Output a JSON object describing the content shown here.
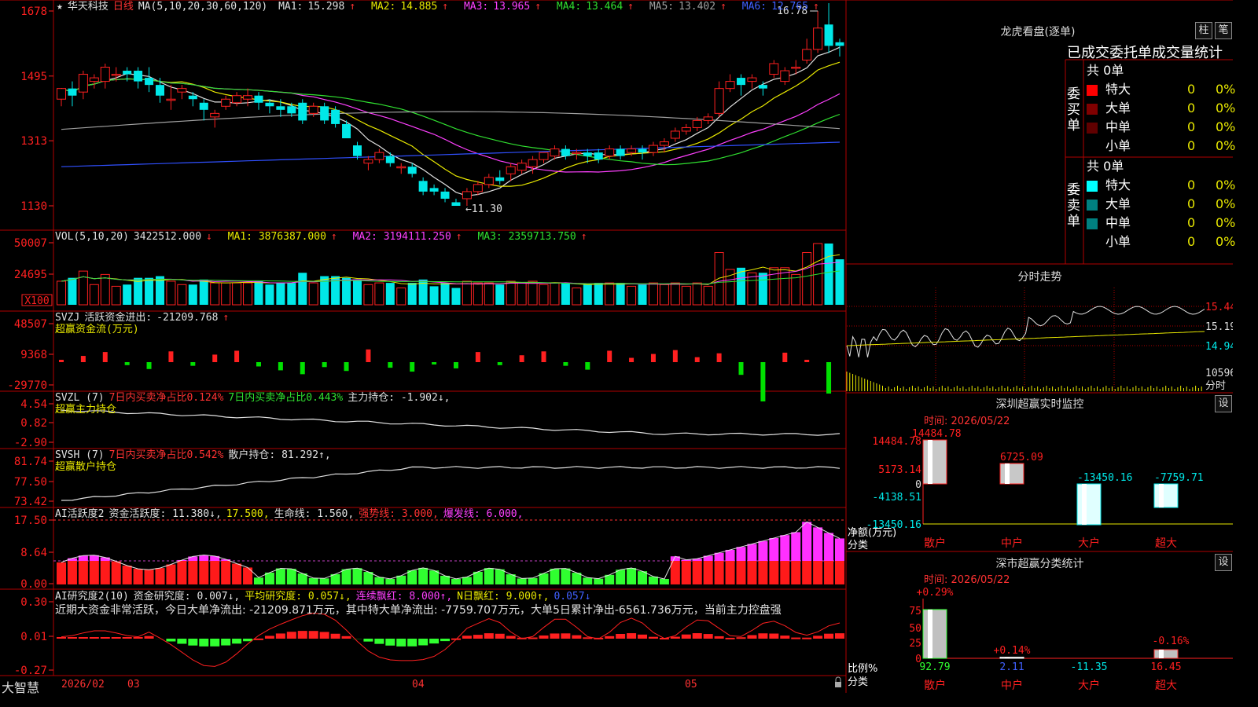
{
  "header": {
    "stock_name": "华天科技",
    "period": "日线",
    "ma_title": "MA(5,10,20,30,60,120)",
    "ma": [
      {
        "label": "MA1:",
        "value": "15.298",
        "arrow": "↑",
        "color": "#e0e0e0"
      },
      {
        "label": "MA2:",
        "value": "14.885",
        "arrow": "↑",
        "color": "#e8e800"
      },
      {
        "label": "MA3:",
        "value": "13.965",
        "arrow": "↑",
        "color": "#ff40ff"
      },
      {
        "label": "MA4:",
        "value": "13.464",
        "arrow": "↑",
        "color": "#30e030"
      },
      {
        "label": "MA5:",
        "value": "13.402",
        "arrow": "↑",
        "color": "#c0c0c0"
      },
      {
        "label": "MA6:",
        "value": "12.765",
        "arrow": "↑",
        "color": "#4060ff"
      }
    ],
    "price_ticks": [
      "1678",
      "1495",
      "1313",
      "1130"
    ],
    "high_mark": "16.78",
    "low_mark": "11.30"
  },
  "vol": {
    "title": "VOL(5,10,20)",
    "value": "3422512.000",
    "value_arrow": "↓",
    "ma1": "3876387.000",
    "ma2": "3194111.250",
    "ma3": "2359713.750",
    "arrow_up": "↑",
    "ticks": [
      "50007",
      "24695"
    ],
    "unit": "X100"
  },
  "svzj": {
    "title": "SVZJ",
    "label": "活跃资金进出:",
    "value": "-21209.768",
    "arrow": "↑",
    "subtitle": "超赢资金流(万元)",
    "ticks": [
      "48507",
      "9368",
      "-29770"
    ]
  },
  "svzl": {
    "title": "SVZL (7)",
    "t1": "7日内买卖净占比0.124%",
    "t2": "7日内买卖净占比0.443%",
    "t3": "主力持仓: -1.902↓,",
    "subtitle": "超赢主力持仓",
    "ticks": [
      "4.54",
      "0.82",
      "-2.90"
    ]
  },
  "svsh": {
    "title": "SVSH (7)",
    "t1": "7日内买卖净占比0.542%",
    "t2": "散户持仓: 81.292↑,",
    "subtitle": "超赢散户持仓",
    "ticks": [
      "81.74",
      "77.50",
      "73.42"
    ]
  },
  "ai1": {
    "title": "AI活跃度2",
    "t1": "资金活跃度: 11.380↓,",
    "t2": "17.500,",
    "t3": "生命线: 1.560,",
    "t4": "强势线: 3.000,",
    "t5": "爆发线: 6.000,",
    "ticks": [
      "17.50",
      "8.64",
      "0.00"
    ]
  },
  "ai2": {
    "title": "AI研究度2(10)",
    "t1": "资金研究度: 0.007↓,",
    "t2": "平均研究度: 0.057↓,",
    "t3": "连续飘红: 8.000↑,",
    "t4": "N日飘红: 9.000↑,",
    "t5": "0.057↓",
    "note": "近期大资金非常活跃，今日大单净流出: -21209.871万元，其中特大单净流出: -7759.707万元，大单5日累计净出-6561.736万元，当前主力控盘强",
    "ticks": [
      "0.30",
      "0.01",
      "-0.27"
    ]
  },
  "xaxis": {
    "brand": "大智慧",
    "labels": [
      "2026/02",
      "03",
      "04",
      "05"
    ]
  },
  "lhkp": {
    "title": "龙虎看盘(逐单)",
    "btn1": "柱",
    "btn2": "笔",
    "tabs_title": "已成交委托单成交量统计",
    "buy_label": "委买单",
    "sell_label": "委卖单",
    "buy_total": "共 0单",
    "sell_total": "共 0单",
    "buy_rows": [
      {
        "name": "特大",
        "count": "0",
        "pct": "0%",
        "color": "#ff0000"
      },
      {
        "name": "大单",
        "count": "0",
        "pct": "0%",
        "color": "#800000"
      },
      {
        "name": "中单",
        "count": "0",
        "pct": "0%",
        "color": "#600000"
      },
      {
        "name": "小单",
        "count": "0",
        "pct": "0%",
        "color": "#000000"
      }
    ],
    "sell_rows": [
      {
        "name": "特大",
        "count": "0",
        "pct": "0%",
        "color": "#00ffff"
      },
      {
        "name": "大单",
        "count": "0",
        "pct": "0%",
        "color": "#008080"
      },
      {
        "name": "中单",
        "count": "0",
        "pct": "0%",
        "color": "#008080"
      },
      {
        "name": "小单",
        "count": "0",
        "pct": "0%",
        "color": "#000000"
      }
    ]
  },
  "fenshi": {
    "title": "分时走势",
    "price_ticks": [
      "15.44",
      "15.19",
      "14.94"
    ],
    "vol_tick": "10596",
    "vol_label": "分时"
  },
  "monitor": {
    "title": "深圳超赢实时监控",
    "btn": "设",
    "date": "时间: 2026/05/22",
    "ticks": [
      "14484.78",
      "5173.14",
      "0",
      "-4138.51",
      "-13450.16"
    ],
    "ylabel": "净额(万元)",
    "xlabel_title": "分类",
    "categories": [
      "散户",
      "中户",
      "大户",
      "超大"
    ],
    "values": [
      14484.78,
      6725.09,
      -13450.16,
      -7759.71
    ],
    "value_labels": [
      "14484.78",
      "6725.09",
      "-13450.16",
      "-7759.71"
    ]
  },
  "classify": {
    "title": "深市超赢分类统计",
    "btn": "设",
    "date": "时间: 2026/05/22",
    "ticks": [
      "75",
      "50",
      "25",
      "0"
    ],
    "ylabel": "比例%",
    "xlabel_title": "分类",
    "categories": [
      "散户",
      "中户",
      "大户",
      "超大"
    ],
    "top_labels": [
      "+0.29%",
      "+0.14%",
      "",
      "-0.16%"
    ],
    "bottom_values": [
      "92.79",
      "2.11",
      "-11.35",
      "16.45"
    ],
    "values": [
      92.79,
      2.11,
      0,
      16.45
    ]
  },
  "chart_data": {
    "type": "candlestick",
    "title": "华天科技 日线",
    "ylim": [
      11.3,
      16.78
    ],
    "candles": [
      [
        14.3,
        14.6,
        14.1,
        14.5
      ],
      [
        14.6,
        14.4,
        14.1,
        14.8
      ],
      [
        14.5,
        15.0,
        14.3,
        15.1
      ],
      [
        14.8,
        14.9,
        14.6,
        15.0
      ],
      [
        14.8,
        15.2,
        14.6,
        15.3
      ],
      [
        15.0,
        15.0,
        14.8,
        15.2
      ],
      [
        15.1,
        15.0,
        14.8,
        15.2
      ],
      [
        15.1,
        14.8,
        14.6,
        15.2
      ],
      [
        14.9,
        14.7,
        14.5,
        15.2
      ],
      [
        14.7,
        14.4,
        14.2,
        14.9
      ],
      [
        14.3,
        14.3,
        14.0,
        14.7
      ],
      [
        14.5,
        14.6,
        14.3,
        14.7
      ],
      [
        14.4,
        14.3,
        14.1,
        14.5
      ],
      [
        14.2,
        14.0,
        13.7,
        14.3
      ],
      [
        13.8,
        13.9,
        13.5,
        14.0
      ],
      [
        14.1,
        14.3,
        14.0,
        14.4
      ],
      [
        14.2,
        14.4,
        14.1,
        14.5
      ],
      [
        14.3,
        14.4,
        14.1,
        14.6
      ],
      [
        14.4,
        14.2,
        14.0,
        14.5
      ],
      [
        14.2,
        14.1,
        13.9,
        14.3
      ],
      [
        14.1,
        14.0,
        13.8,
        14.3
      ],
      [
        14.1,
        13.9,
        13.8,
        14.2
      ],
      [
        14.2,
        13.7,
        13.6,
        14.3
      ],
      [
        13.9,
        14.1,
        13.8,
        14.2
      ],
      [
        14.1,
        13.7,
        13.6,
        14.2
      ],
      [
        14.0,
        13.6,
        13.5,
        14.1
      ],
      [
        13.6,
        13.2,
        13.2,
        13.7
      ],
      [
        13.0,
        12.7,
        12.6,
        13.1
      ],
      [
        12.5,
        12.6,
        12.3,
        12.7
      ],
      [
        12.6,
        12.8,
        12.5,
        12.9
      ],
      [
        12.7,
        12.5,
        12.4,
        12.8
      ],
      [
        12.4,
        12.4,
        12.2,
        12.5
      ],
      [
        12.4,
        12.2,
        12.1,
        12.5
      ],
      [
        12.0,
        11.7,
        11.6,
        12.1
      ],
      [
        11.8,
        11.7,
        11.6,
        11.9
      ],
      [
        11.7,
        11.5,
        11.4,
        11.8
      ],
      [
        11.4,
        11.3,
        11.3,
        11.5
      ],
      [
        11.5,
        11.7,
        11.3,
        11.8
      ],
      [
        11.7,
        11.9,
        11.6,
        12.0
      ],
      [
        11.9,
        12.1,
        11.8,
        12.2
      ],
      [
        12.1,
        12.0,
        11.9,
        12.3
      ],
      [
        12.2,
        12.4,
        12.0,
        12.5
      ],
      [
        12.3,
        12.5,
        12.2,
        12.6
      ],
      [
        12.4,
        12.6,
        12.2,
        12.7
      ],
      [
        12.6,
        12.8,
        12.5,
        12.8
      ],
      [
        12.7,
        12.9,
        12.6,
        13.0
      ],
      [
        12.9,
        12.7,
        12.6,
        13.0
      ],
      [
        12.8,
        12.8,
        12.6,
        12.9
      ],
      [
        12.8,
        12.7,
        12.5,
        12.9
      ],
      [
        12.8,
        12.6,
        12.5,
        12.9
      ],
      [
        12.7,
        12.9,
        12.6,
        13.0
      ],
      [
        12.9,
        12.7,
        12.6,
        13.0
      ],
      [
        12.8,
        12.9,
        12.7,
        13.0
      ],
      [
        12.9,
        12.8,
        12.6,
        13.0
      ],
      [
        12.8,
        13.0,
        12.7,
        13.1
      ],
      [
        13.0,
        13.1,
        12.8,
        13.2
      ],
      [
        13.2,
        13.4,
        13.1,
        13.5
      ],
      [
        13.4,
        13.5,
        13.3,
        13.6
      ],
      [
        13.5,
        13.7,
        13.4,
        13.8
      ],
      [
        13.7,
        13.8,
        13.6,
        13.9
      ],
      [
        13.9,
        14.6,
        13.8,
        14.8
      ],
      [
        14.6,
        14.8,
        14.5,
        15.0
      ],
      [
        14.9,
        14.7,
        14.4,
        15.0
      ],
      [
        14.8,
        14.9,
        14.6,
        15.0
      ],
      [
        14.7,
        14.6,
        14.4,
        14.8
      ],
      [
        15.0,
        15.3,
        14.9,
        15.4
      ],
      [
        14.8,
        15.1,
        14.7,
        15.2
      ],
      [
        15.2,
        15.2,
        15.0,
        15.4
      ],
      [
        15.4,
        15.7,
        15.3,
        16.0
      ],
      [
        15.7,
        16.3,
        15.6,
        16.78
      ],
      [
        16.4,
        15.8,
        15.6,
        17.0
      ],
      [
        15.9,
        15.8,
        15.5,
        16.0
      ]
    ],
    "ma_lines": [
      "MA1",
      "MA2",
      "MA3",
      "MA4",
      "MA5",
      "MA6"
    ]
  }
}
